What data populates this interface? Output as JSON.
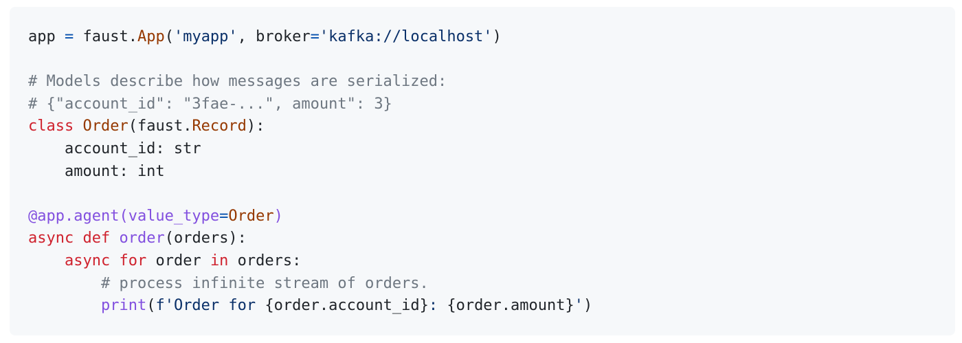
{
  "code_block": {
    "language": "python",
    "colors": {
      "background": "#f6f8fa",
      "text": "#1f2328",
      "keyword": "#cf222e",
      "function": "#8250df",
      "class": "#953800",
      "string": "#0a3069",
      "operator": "#0550ae",
      "comment": "#6e7781"
    },
    "lines": [
      {
        "tokens": [
          {
            "t": "app ",
            "c": ""
          },
          {
            "t": "=",
            "c": "op"
          },
          {
            "t": " faust.",
            "c": ""
          },
          {
            "t": "App",
            "c": "cls"
          },
          {
            "t": "(",
            "c": ""
          },
          {
            "t": "'myapp'",
            "c": "str"
          },
          {
            "t": ", broker",
            "c": ""
          },
          {
            "t": "=",
            "c": "op"
          },
          {
            "t": "'kafka://localhost'",
            "c": "str"
          },
          {
            "t": ")",
            "c": ""
          }
        ]
      },
      {
        "tokens": []
      },
      {
        "tokens": [
          {
            "t": "# Models describe how messages are serialized:",
            "c": "cm"
          }
        ]
      },
      {
        "tokens": [
          {
            "t": "# {\"account_id\": \"3fae-...\", amount\": 3}",
            "c": "cm"
          }
        ]
      },
      {
        "tokens": [
          {
            "t": "class",
            "c": "kw"
          },
          {
            "t": " ",
            "c": ""
          },
          {
            "t": "Order",
            "c": "cls"
          },
          {
            "t": "(faust.",
            "c": ""
          },
          {
            "t": "Record",
            "c": "cls"
          },
          {
            "t": "):",
            "c": ""
          }
        ]
      },
      {
        "tokens": [
          {
            "t": "    account_id: str",
            "c": ""
          }
        ]
      },
      {
        "tokens": [
          {
            "t": "    amount: int",
            "c": ""
          }
        ]
      },
      {
        "tokens": []
      },
      {
        "tokens": [
          {
            "t": "@app.agent(value_type",
            "c": "fn"
          },
          {
            "t": "=",
            "c": "op"
          },
          {
            "t": "Order",
            "c": "cls"
          },
          {
            "t": ")",
            "c": "fn"
          }
        ]
      },
      {
        "tokens": [
          {
            "t": "async",
            "c": "kw"
          },
          {
            "t": " ",
            "c": ""
          },
          {
            "t": "def",
            "c": "kw"
          },
          {
            "t": " ",
            "c": ""
          },
          {
            "t": "order",
            "c": "fn"
          },
          {
            "t": "(orders):",
            "c": ""
          }
        ]
      },
      {
        "tokens": [
          {
            "t": "    ",
            "c": ""
          },
          {
            "t": "async",
            "c": "kw"
          },
          {
            "t": " ",
            "c": ""
          },
          {
            "t": "for",
            "c": "kw"
          },
          {
            "t": " order ",
            "c": ""
          },
          {
            "t": "in",
            "c": "kw"
          },
          {
            "t": " orders:",
            "c": ""
          }
        ]
      },
      {
        "tokens": [
          {
            "t": "        ",
            "c": ""
          },
          {
            "t": "# process infinite stream of orders.",
            "c": "cm"
          }
        ]
      },
      {
        "tokens": [
          {
            "t": "        ",
            "c": ""
          },
          {
            "t": "print",
            "c": "fn"
          },
          {
            "t": "(",
            "c": ""
          },
          {
            "t": "f'Order for ",
            "c": "str"
          },
          {
            "t": "{order.account_id}",
            "c": ""
          },
          {
            "t": ": ",
            "c": "str"
          },
          {
            "t": "{order.amount}",
            "c": ""
          },
          {
            "t": "'",
            "c": "str"
          },
          {
            "t": ")",
            "c": ""
          }
        ]
      }
    ]
  }
}
